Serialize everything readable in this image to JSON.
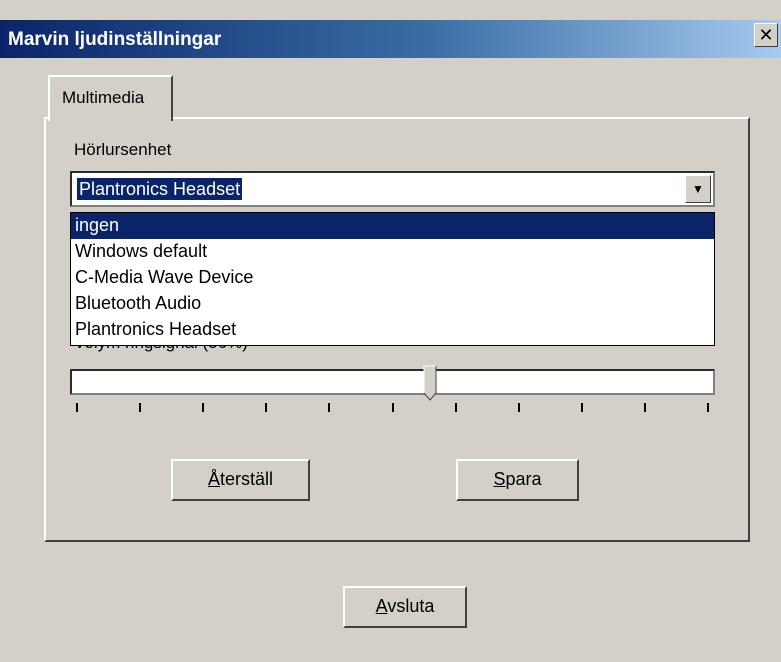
{
  "window": {
    "title": "Marvin ljudinställningar",
    "close_symbol": "✕"
  },
  "tabs": [
    {
      "label": "Multimedia"
    }
  ],
  "headset": {
    "label": "Hörlursenhet",
    "selected_value": "Plantronics Headset",
    "options": [
      "ingen",
      "Windows default",
      "C-Media Wave Device",
      "Bluetooth Audio",
      "Plantronics Headset"
    ],
    "highlighted_option": "ingen"
  },
  "volume": {
    "label": "Volym ringsignal (56%)",
    "value_fraction": 0.56,
    "tick_count": 11
  },
  "buttons": {
    "reset": {
      "accel": "Å",
      "rest": "terställ"
    },
    "save": {
      "accel": "S",
      "rest": "para"
    },
    "exit": {
      "accel": "A",
      "rest": "vsluta"
    }
  },
  "colors": {
    "title_start": "#0a246a",
    "title_end": "#a6caf0",
    "highlight": "#0a246a",
    "face": "#d4d0c8"
  }
}
